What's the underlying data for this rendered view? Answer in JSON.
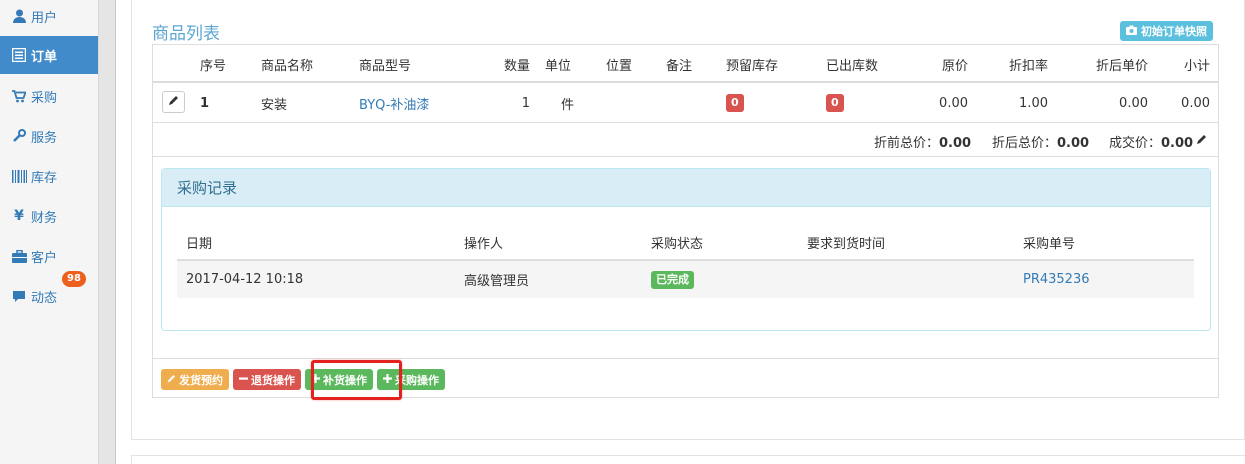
{
  "sidebar": {
    "items": [
      {
        "label": "用户",
        "icon": "user-icon"
      },
      {
        "label": "订单",
        "icon": "list-alt-icon",
        "active": true
      },
      {
        "label": "采购",
        "icon": "shopping-cart-icon"
      },
      {
        "label": "服务",
        "icon": "wrench-icon"
      },
      {
        "label": "库存",
        "icon": "barcode-icon"
      },
      {
        "label": "财务",
        "icon": "yen-icon"
      },
      {
        "label": "客户",
        "icon": "briefcase-icon"
      },
      {
        "label": "动态",
        "icon": "comment-icon",
        "badge": "98"
      }
    ]
  },
  "goods": {
    "title": "商品列表",
    "snapshot_button": "初始订单快照",
    "columns": [
      "序号",
      "商品名称",
      "商品型号",
      "数量",
      "单位",
      "位置",
      "备注",
      "预留库存",
      "已出库数",
      "原价",
      "折扣率",
      "折后单价",
      "小计"
    ],
    "row": {
      "index": "1",
      "name": "安装",
      "model": "BYQ-补油漆",
      "quantity": "1",
      "unit": "件",
      "location": "",
      "note": "",
      "reserved": "0",
      "shipped": "0",
      "price": "0.00",
      "discount": "1.00",
      "discounted_price": "0.00",
      "subtotal": "0.00"
    },
    "totals": {
      "before_label": "折前总价：",
      "before_value": "0.00",
      "after_label": "折后总价：",
      "after_value": "0.00",
      "deal_label": "成交价：",
      "deal_value": "0.00"
    }
  },
  "purchase": {
    "title": "采购记录",
    "columns": [
      "日期",
      "操作人",
      "采购状态",
      "要求到货时间",
      "采购单号"
    ],
    "rows": [
      {
        "date": "2017-04-12 10:18",
        "operator": "高级管理员",
        "status": "已完成",
        "due": "",
        "order_no": "PR435236"
      }
    ]
  },
  "actions": {
    "ship_reserve": "发货预约",
    "return_op": "退货操作",
    "restock_op": "补货操作",
    "purchase_op": "采购操作"
  },
  "colors": {
    "primary": "#428bca",
    "link": "#337ab7",
    "danger": "#d9534f",
    "success": "#5cb85c",
    "warning": "#f0ad4e",
    "info": "#5bc0de",
    "highlight": "#e0231f"
  }
}
